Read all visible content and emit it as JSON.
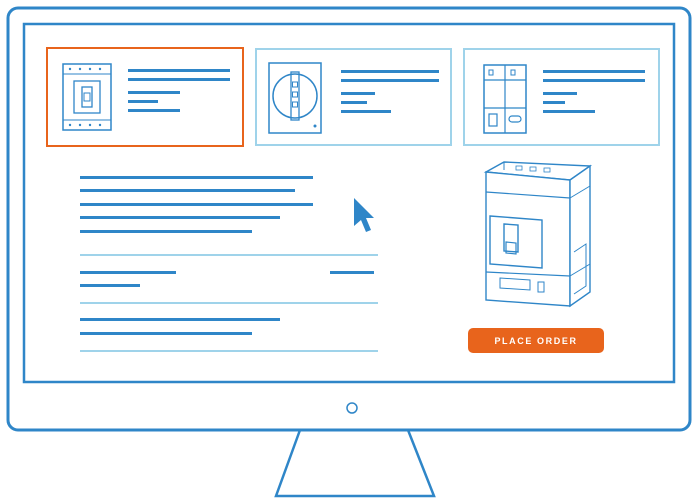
{
  "order_button": {
    "label": "PLACE ORDER"
  },
  "colors": {
    "outline": "#2f86c8",
    "light_outline": "#9fd3ea",
    "accent": "#e8641c"
  },
  "product_cards": [
    {
      "name": "molded-case-breaker",
      "selected": true
    },
    {
      "name": "rotary-disconnect-switch",
      "selected": false
    },
    {
      "name": "modular-din-breaker",
      "selected": false
    }
  ],
  "icons": {
    "cursor": "pointer-arrow-icon",
    "power": "power-indicator-icon"
  }
}
